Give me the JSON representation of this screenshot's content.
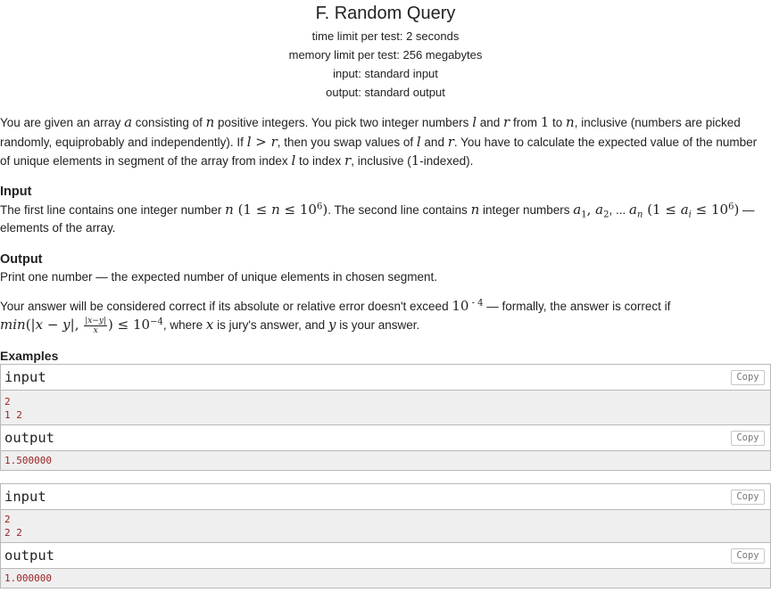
{
  "problem": {
    "title": "F. Random Query",
    "time_limit": "time limit per test: 2 seconds",
    "memory_limit": "memory limit per test: 256 megabytes",
    "input_spec": "input: standard input",
    "output_spec": "output: standard output"
  },
  "statement": {
    "t1": "You are given an array ",
    "v_a": "a",
    "t2": " consisting of ",
    "v_n": "n",
    "t3": " positive integers. You pick two integer numbers ",
    "v_l": "l",
    "t4": " and ",
    "v_r": "r",
    "t5": " from ",
    "v_1": "1",
    "t6": " to ",
    "v_n2": "n",
    "t7": ", inclusive (numbers are picked randomly, equiprobably and independently). If ",
    "cond": "l > r",
    "t8": ", then you swap values of ",
    "v_l2": "l",
    "t9": " and ",
    "v_r2": "r",
    "t10": ". You have to calculate the expected value of the number of unique elements in segment of the array from index ",
    "v_l3": "l",
    "t11": " to index ",
    "v_r3": "r",
    "t12": ", inclusive (",
    "v_1b": "1",
    "t13": "-indexed)."
  },
  "input_section": {
    "title": "Input",
    "t1": "The first line contains one integer number ",
    "v_n": "n",
    "range1_pre": " (1 ≤ ",
    "range1_mid": "n",
    "range1_post": " ≤ 10",
    "range1_sup": "6",
    "range1_end": ")",
    "t2": ". The second line contains ",
    "v_n2": "n",
    "t3": " integer numbers ",
    "a1": "a",
    "a1_sub": "1",
    "comma1": ", ",
    "a2": "a",
    "a2_sub": "2",
    "dots": ", ... ",
    "an": "a",
    "an_sub": "n",
    "range2_pre": " (1 ≤ ",
    "range2_ai": "a",
    "range2_ai_sub": "i",
    "range2_post": " ≤ 10",
    "range2_sup": "6",
    "range2_end": ")",
    "t4": " — elements of the array."
  },
  "output_section": {
    "title": "Output",
    "text": "Print one number — the expected number of unique elements in chosen segment.",
    "t1": "Your answer will be considered correct if its absolute or relative error doesn't exceed ",
    "tol_base": "10",
    "tol_exp": " - 4",
    "t2": " — formally, the answer is correct if ",
    "f_min": "min",
    "f_open": "(|",
    "f_x": "x",
    "f_minus": " − ",
    "f_y": "y",
    "f_mid": "|, ",
    "frac_num": "|x−y|",
    "frac_den": "x",
    "f_close": ") ≤ 10",
    "f_exp": "−4",
    "t3": ", where ",
    "v_x": "x",
    "t4": " is jury's answer, and ",
    "v_y": "y",
    "t5": " is your answer."
  },
  "examples": {
    "title": "Examples",
    "copy_label": "Copy",
    "input_label": "input",
    "output_label": "output",
    "samples": [
      {
        "input": "2\n1 2",
        "output": "1.500000"
      },
      {
        "input": "2\n2 2",
        "output": "1.000000"
      }
    ]
  }
}
